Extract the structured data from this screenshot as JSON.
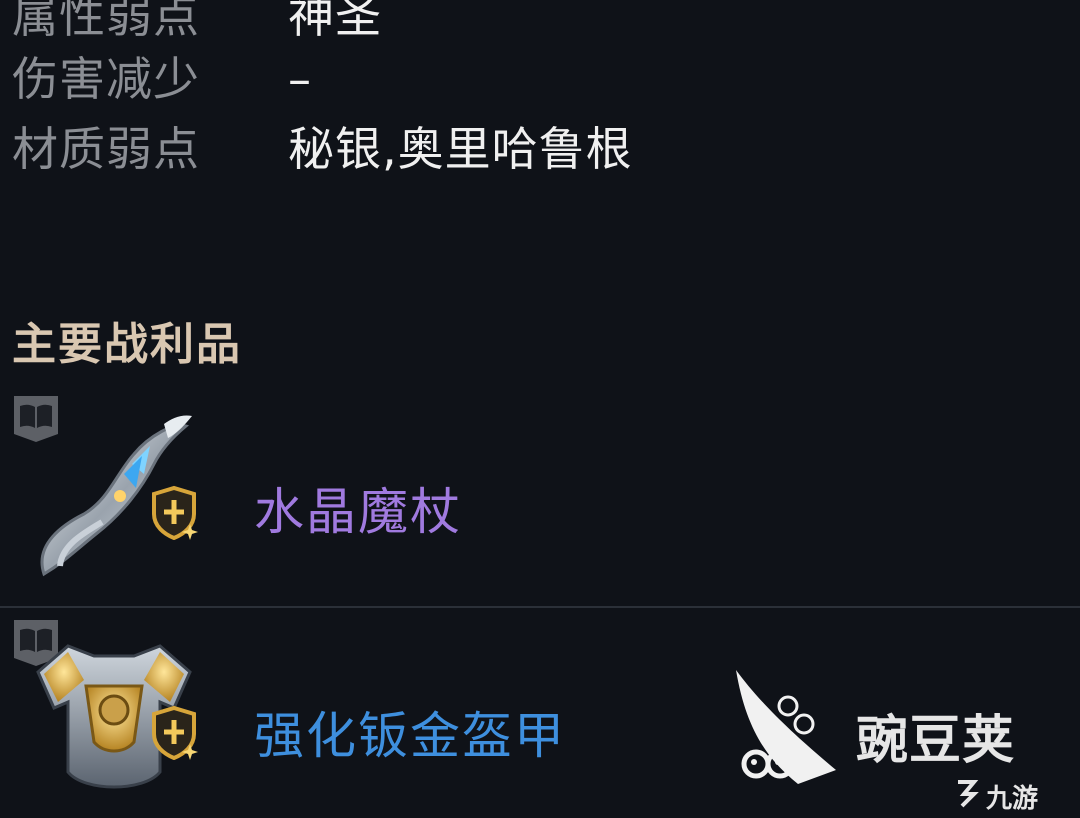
{
  "stats": [
    {
      "key": "属性弱点",
      "value": "神圣"
    },
    {
      "key": "伤害减少",
      "value": "–"
    },
    {
      "key": "材质弱点",
      "value": "秘银,奥里哈鲁根"
    }
  ],
  "loot_section": {
    "title": "主要战利品",
    "items": [
      {
        "name": "水晶魔杖",
        "icon": "crystal-staff-icon",
        "color": "#a07adf"
      },
      {
        "name": "强化钣金盔甲",
        "icon": "plate-armor-icon",
        "color": "#3e8fde"
      }
    ]
  },
  "watermark": {
    "brand": "豌豆荚",
    "sub": "九游"
  },
  "colors": {
    "background": "#0f1218",
    "label": "#8b8e94",
    "value": "#f0f0f0",
    "section_title": "#d9c7b1",
    "badge_gold": "#d7a53a"
  }
}
